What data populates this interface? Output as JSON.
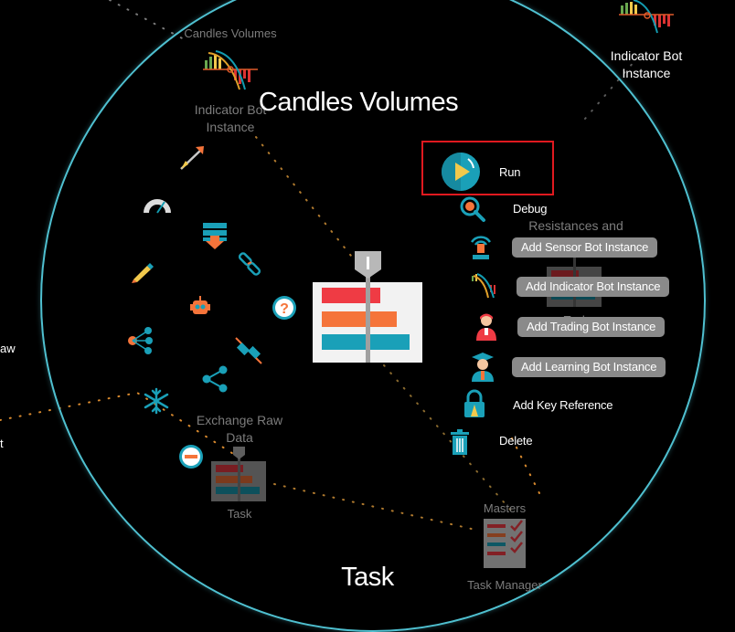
{
  "canvas": {
    "center_title": "Candles Volumes",
    "bottom_title": "Task"
  },
  "menu": {
    "run": "Run",
    "debug": "Debug",
    "add_sensor": "Add Sensor Bot Instance",
    "add_indicator": "Add Indicator Bot Instance",
    "add_trading": "Add Trading Bot Instance",
    "add_learning": "Add Learning Bot Instance",
    "add_key_reference": "Add Key Reference",
    "delete": "Delete"
  },
  "nodes": {
    "candles_volumes_small": "Candles Volumes",
    "indicator_bot_instance": "Indicator Bot\nInstance",
    "indicator_bot_instance_top": "Indicator Bot\nInstance",
    "resistances_and": "Resistances and",
    "task_ghost": "Task",
    "exchange_raw_data": "Exchange Raw\nData",
    "task_bottom_left": "Task",
    "masters": "Masters",
    "task_manager": "Task Manager",
    "edge_left_aw": "aw",
    "edge_left_t": "t"
  },
  "colors": {
    "ring": "#4fc0d0",
    "selection": "#e0191f",
    "button_bg": "#8a8a8a",
    "task_red": "#ef3b44",
    "task_orange": "#f5743a",
    "task_teal": "#139bb0"
  }
}
